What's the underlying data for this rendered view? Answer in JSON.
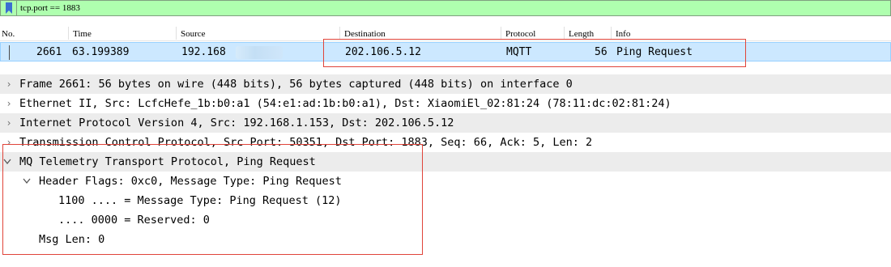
{
  "filter": {
    "text": "tcp.port == 1883",
    "icon": "bookmark-icon",
    "background": "#afffaf"
  },
  "columns": {
    "no": "No.",
    "time": "Time",
    "source": "Source",
    "destination": "Destination",
    "protocol": "Protocol",
    "length": "Length",
    "info": "Info"
  },
  "packet": {
    "no": "2661",
    "time": "63.199389",
    "source": "192.168",
    "destination": "202.106.5.12",
    "protocol": "MQTT",
    "length": "56",
    "info": "Ping Request",
    "selected_color": "#cce8ff"
  },
  "details": [
    {
      "text": "Frame 2661: 56 bytes on wire (448 bits), 56 bytes captured (448 bits) on interface 0",
      "expanded": false
    },
    {
      "text": "Ethernet II, Src: LcfcHefe_1b:b0:a1 (54:e1:ad:1b:b0:a1), Dst: XiaomiEl_02:81:24 (78:11:dc:02:81:24)",
      "expanded": false
    },
    {
      "text": "Internet Protocol Version 4, Src: 192.168.1.153, Dst: 202.106.5.12",
      "expanded": false
    },
    {
      "text": "Transmission Control Protocol, Src Port: 50351, Dst Port: 1883, Seq: 66, Ack: 5, Len: 2",
      "expanded": false
    },
    {
      "text": "MQ Telemetry Transport Protocol, Ping Request",
      "expanded": true
    },
    {
      "text": "Header Flags: 0xc0, Message Type: Ping Request",
      "expanded": true
    },
    {
      "text": "1100 .... = Message Type: Ping Request (12)"
    },
    {
      "text": ".... 0000 = Reserved: 0"
    },
    {
      "text": "Msg Len: 0"
    }
  ],
  "annotation_color": "#e0443a"
}
